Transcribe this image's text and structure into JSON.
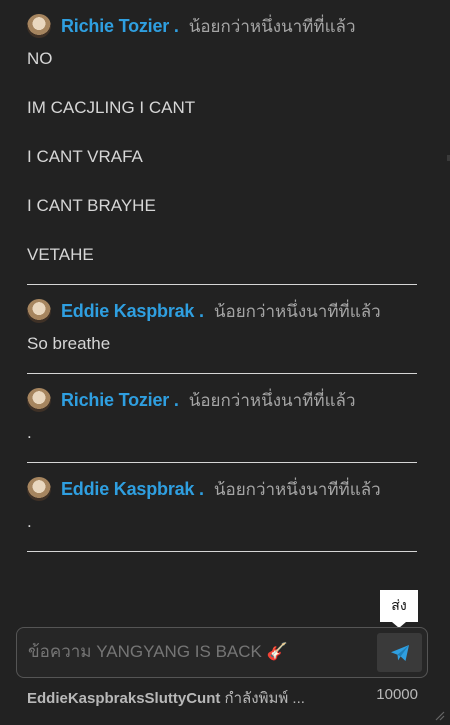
{
  "messages": [
    {
      "author": "Richie Tozier .",
      "time": "น้อยกว่าหนึ่งนาทีที่แล้ว",
      "lines": [
        "NO",
        "IM CACJLING I CANT",
        "I CANT VRAFA",
        "I CANT BRAYHE",
        "VETAHE"
      ]
    },
    {
      "author": "Eddie Kaspbrak .",
      "time": "น้อยกว่าหนึ่งนาทีที่แล้ว",
      "lines": [
        "So breathe"
      ]
    },
    {
      "author": "Richie Tozier .",
      "time": "น้อยกว่าหนึ่งนาทีที่แล้ว",
      "lines": [
        "."
      ]
    },
    {
      "author": "Eddie Kaspbrak .",
      "time": "น้อยกว่าหนึ่งนาทีที่แล้ว",
      "lines": [
        "."
      ]
    }
  ],
  "composer": {
    "placeholder": "ข้อความ YANGYANG IS BACK 🎸",
    "send_tooltip": "ส่ง"
  },
  "status": {
    "typing_user": "EddieKaspbraksSluttyCunt",
    "typing_text": "กำลังพิมพ์ ...",
    "char_limit": "10000"
  },
  "icons": {
    "send": "paper-plane-icon",
    "resize": "resize-handle-icon"
  },
  "colors": {
    "author": "#2f9fe0",
    "send_icon": "#2f9fe0",
    "background": "#222222"
  }
}
